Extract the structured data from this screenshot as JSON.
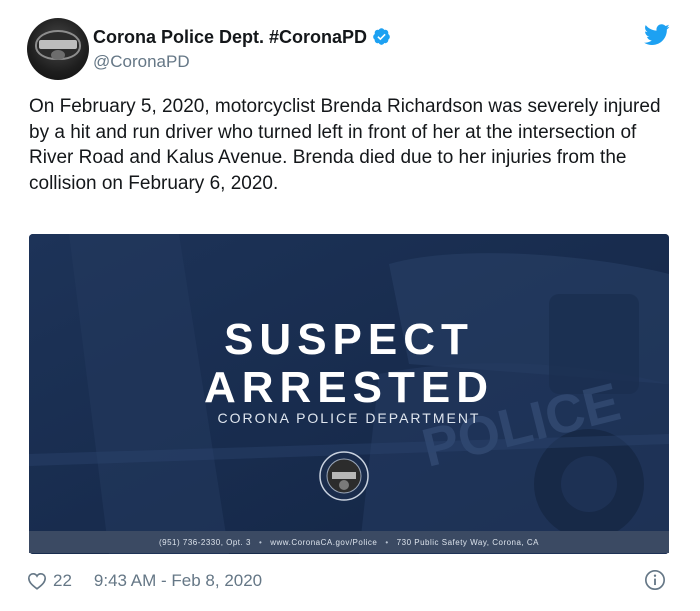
{
  "author": {
    "display_name": "Corona Police Dept. #CoronaPD",
    "handle": "@CoronaPD",
    "verified": true
  },
  "tweet": {
    "text": "On February 5, 2020, motorcyclist Brenda Richardson was severely injured by a hit and run driver who turned left in front of her at the intersection of River Road and Kalus Avenue.  Brenda died due to her injuries from the collision on February 6, 2020."
  },
  "media": {
    "headline_line1": "SUSPECT",
    "headline_line2": "ARRESTED",
    "department": "CORONA POLICE DEPARTMENT",
    "footer_phone": "(951) 736-2330, Opt. 3",
    "footer_url": "www.CoronaCA.gov/Police",
    "footer_address": "730 Public Safety Way, Corona, CA",
    "footer_separator": "•"
  },
  "footer": {
    "like_count": "22",
    "timestamp": "9:43 AM - Feb 8, 2020"
  },
  "colors": {
    "verified_blue": "#1da1f2",
    "twitter_blue": "#1da1f2",
    "media_navy": "#1b2f52"
  },
  "icons": [
    "verified-badge-icon",
    "twitter-bird-icon",
    "heart-icon",
    "info-icon"
  ]
}
